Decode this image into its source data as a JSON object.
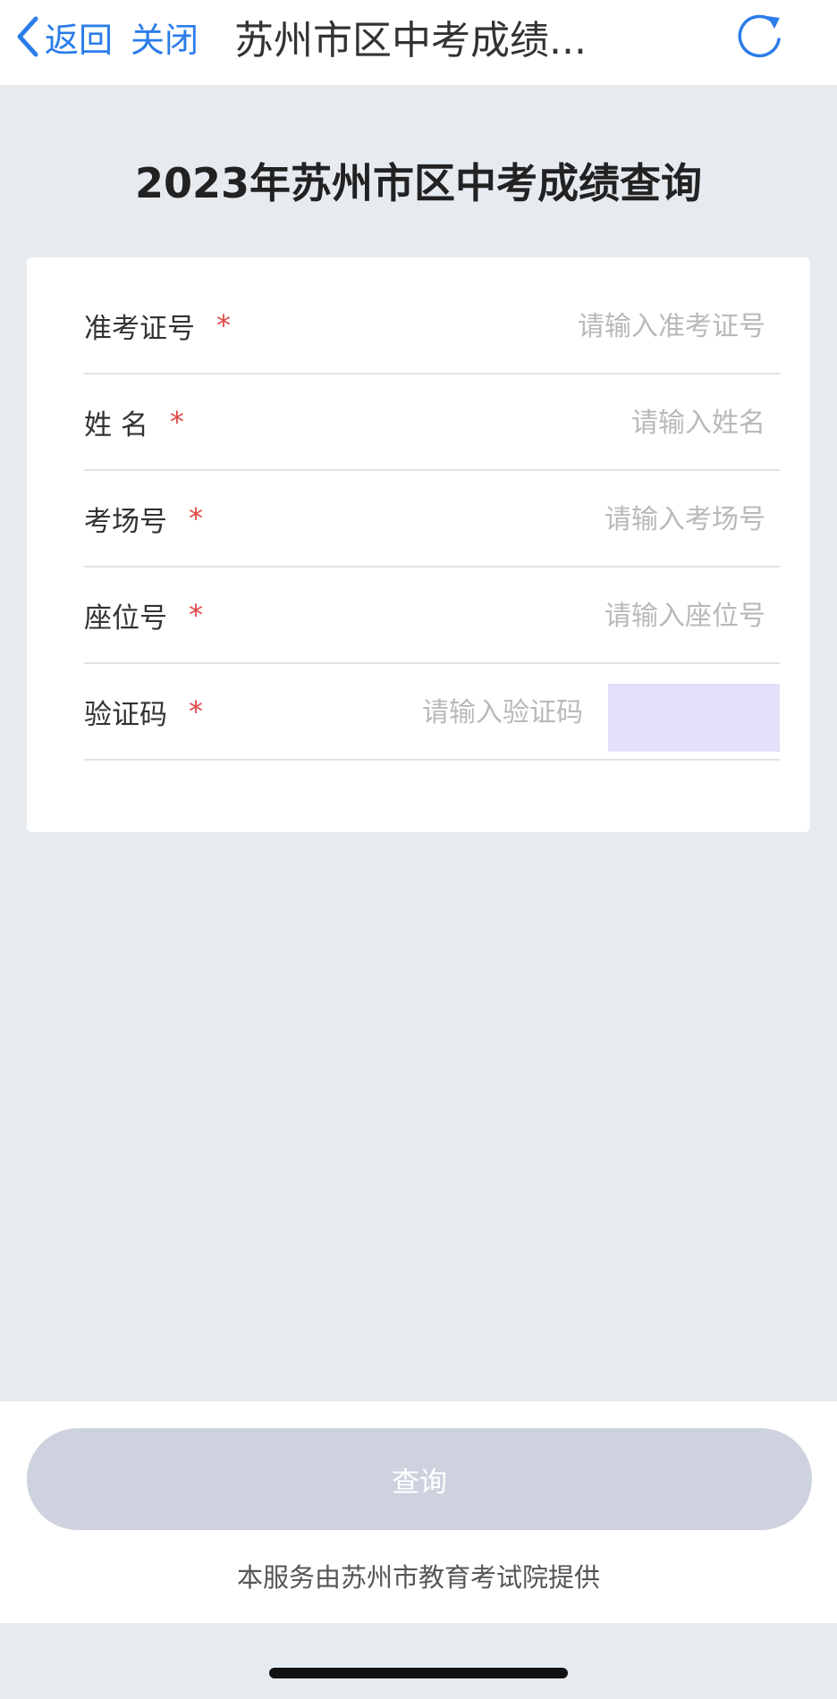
{
  "nav": {
    "back_label": "返回",
    "close_label": "关闭",
    "title": "苏州市区中考成绩...",
    "accent_color": "#2b7de9"
  },
  "page": {
    "heading": "2023年苏州市区中考成绩查询"
  },
  "form": {
    "required_mark": "*",
    "fields": [
      {
        "label": "准考证号",
        "placeholder": "请输入准考证号",
        "value": ""
      },
      {
        "label": "姓 名",
        "placeholder": "请输入姓名",
        "value": ""
      },
      {
        "label": "考场号",
        "placeholder": "请输入考场号",
        "value": ""
      },
      {
        "label": "座位号",
        "placeholder": "请输入座位号",
        "value": ""
      },
      {
        "label": "验证码",
        "placeholder": "请输入验证码",
        "value": ""
      }
    ]
  },
  "footer": {
    "query_button_label": "查询",
    "provider_text": "本服务由苏州市教育考试院提供"
  },
  "icons": {
    "back": "chevron-left-icon",
    "refresh": "refresh-icon"
  }
}
